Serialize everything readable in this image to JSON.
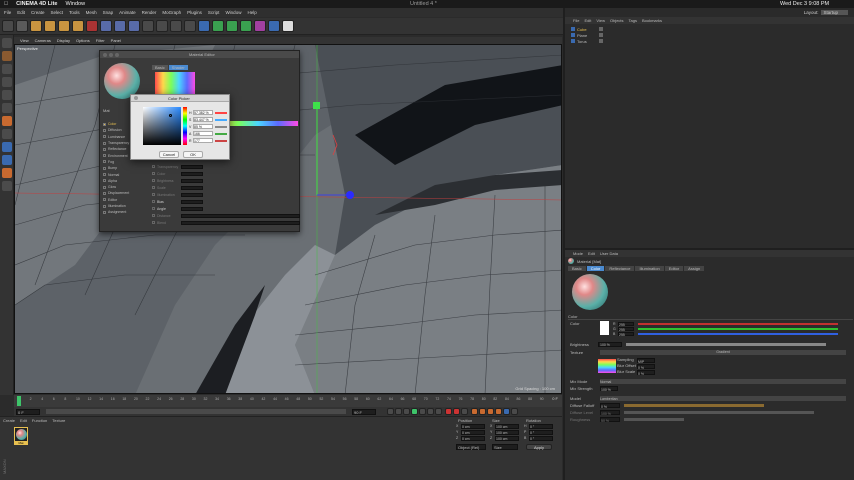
{
  "mac": {
    "app": "CINEMA 4D Lite",
    "window": "Window",
    "title": "Untitled 4 *",
    "clock": "Wed Dec 3  9:08 PM"
  },
  "menu": [
    "File",
    "Edit",
    "Create",
    "Select",
    "Tools",
    "Mesh",
    "Snap",
    "Animate",
    "Render",
    "MoGraph",
    "Plugins",
    "Script",
    "Window",
    "Help"
  ],
  "layout": {
    "label": "Layout:",
    "value": "Startup"
  },
  "vpmenu": [
    "View",
    "Cameras",
    "Display",
    "Options",
    "Filter",
    "Panel"
  ],
  "viewport": {
    "label": "Perspective",
    "grid": "Grid Spacing : 100 cm"
  },
  "timeline": {
    "ticks": [
      "0",
      "2",
      "4",
      "6",
      "8",
      "10",
      "12",
      "14",
      "16",
      "18",
      "20",
      "22",
      "24",
      "26",
      "28",
      "30",
      "32",
      "34",
      "36",
      "38",
      "40",
      "42",
      "44",
      "46",
      "48",
      "50",
      "52",
      "54",
      "56",
      "58",
      "60",
      "62",
      "64",
      "66",
      "68",
      "70",
      "72",
      "74",
      "76",
      "78",
      "80",
      "82",
      "84",
      "86",
      "88",
      "90"
    ],
    "frame": "0 F",
    "start": "0 F",
    "end": "90 F",
    "current": "90 F"
  },
  "matmgr": {
    "menu": [
      "Create",
      "Edit",
      "Function",
      "Texture"
    ],
    "mat_label": "Mat"
  },
  "coords": {
    "headers": [
      "Position",
      "Size",
      "Rotation"
    ],
    "rows": [
      [
        "X",
        "0 cm",
        "X",
        "100 cm",
        "H",
        "0 °"
      ],
      [
        "Y",
        "0 cm",
        "Y",
        "100 cm",
        "P",
        "0 °"
      ],
      [
        "Z",
        "0 cm",
        "Z",
        "100 cm",
        "B",
        "0 °"
      ]
    ],
    "mode1": "Object (Rel)",
    "mode2": "Size",
    "apply": "Apply"
  },
  "objmgr": {
    "menu": [
      "File",
      "Edit",
      "View",
      "Objects",
      "Tags",
      "Bookmarks"
    ],
    "items": [
      "Cube",
      "Plane",
      "Torus"
    ]
  },
  "attr": {
    "menu": [
      "Mode",
      "Edit",
      "User Data"
    ],
    "title": "Material [Mat]",
    "tabs": [
      "Basic",
      "Color",
      "Reflectance",
      "Illumination",
      "Editor",
      "Assign"
    ],
    "section": "Color",
    "color_label": "Color",
    "rgb": [
      {
        "k": "R",
        "v": "255"
      },
      {
        "k": "G",
        "v": "255"
      },
      {
        "k": "B",
        "v": "255"
      }
    ],
    "brightness_label": "Brightness",
    "brightness": "100 %",
    "texture_label": "Texture",
    "texture_value": "Gradient",
    "sampling_label": "Sampling",
    "sampling": "MIP",
    "blur_offset_label": "Blur Offset",
    "blur_offset": "0 %",
    "blur_scale_label": "Blur Scale",
    "blur_scale": "0 %",
    "mix_mode_label": "Mix Mode",
    "mix_mode": "Normal",
    "mix_strength_label": "Mix Strength",
    "mix_strength": "100 %",
    "model_label": "Model",
    "model": "Lambertian",
    "diffuse_falloff_label": "Diffuse Falloff",
    "diffuse_falloff": "0 %",
    "diffuse_level_label": "Diffuse Level",
    "diffuse_level": "100 %",
    "roughness_label": "Roughness",
    "roughness": "50 %"
  },
  "matedit": {
    "title": "Material Editor",
    "name": "Mat",
    "tabs": [
      "Basic",
      "Shader"
    ],
    "channels": [
      "Color",
      "Diffusion",
      "Luminance",
      "Transparency",
      "Reflectance",
      "Environment",
      "Fog",
      "Bump",
      "Normal",
      "Alpha",
      "Glow",
      "Displacement",
      "Editor",
      "Illumination",
      "Assignment"
    ],
    "fields": [
      "Transparency",
      "Color",
      "Brightness",
      "Scale",
      "Illumination",
      "Bias",
      "Angle",
      "Distance",
      "Blend"
    ]
  },
  "picker": {
    "title": "Color Picker",
    "sliders": [
      {
        "k": "H",
        "v": "57.382 %"
      },
      {
        "k": "S",
        "v": "83.447 %"
      },
      {
        "k": "V",
        "v": "85 %"
      },
      {
        "k": "A",
        "v": "166"
      },
      {
        "k": "R",
        "v": "177"
      }
    ],
    "cancel": "Cancel",
    "ok": "OK"
  },
  "colors": {
    "accent": "#4a8ad0",
    "selected": "#e8c050",
    "axis_x": "#e04040",
    "axis_y": "#40e040",
    "axis_z": "#4040e0"
  },
  "icons": [
    "apple-icon",
    "undo-icon",
    "move-icon",
    "scale-icon",
    "rotate-icon",
    "x-axis-icon",
    "y-axis-icon",
    "z-axis-icon",
    "render-icon",
    "cube-icon",
    "play-icon"
  ]
}
